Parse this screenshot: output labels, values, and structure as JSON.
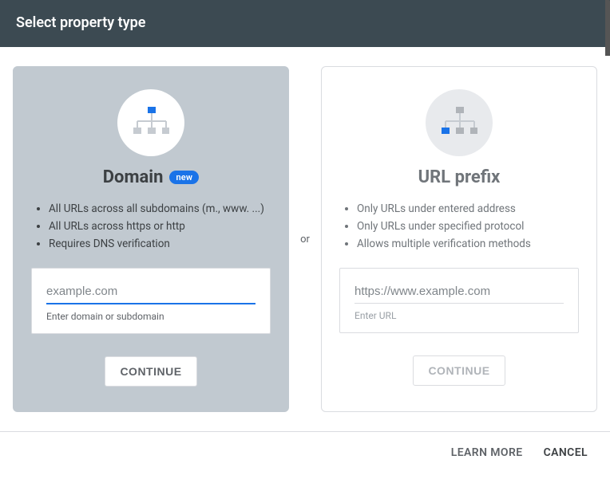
{
  "header": {
    "title": "Select property type"
  },
  "divider_text": "or",
  "cards": {
    "domain": {
      "title": "Domain",
      "badge": "new",
      "bullets": [
        "All URLs across all subdomains (m., www. ...)",
        "All URLs across https or http",
        "Requires DNS verification"
      ],
      "input_placeholder": "example.com",
      "input_helper": "Enter domain or subdomain",
      "continue_label": "CONTINUE"
    },
    "url_prefix": {
      "title": "URL prefix",
      "bullets": [
        "Only URLs under entered address",
        "Only URLs under specified protocol",
        "Allows multiple verification methods"
      ],
      "input_placeholder": "https://www.example.com",
      "input_helper": "Enter URL",
      "continue_label": "CONTINUE"
    }
  },
  "footer": {
    "learn_more": "LEARN MORE",
    "cancel": "CANCEL"
  },
  "colors": {
    "accent": "#1a73e8",
    "selected_bg": "#c1c9d0",
    "header_bg": "#3c4a52"
  }
}
